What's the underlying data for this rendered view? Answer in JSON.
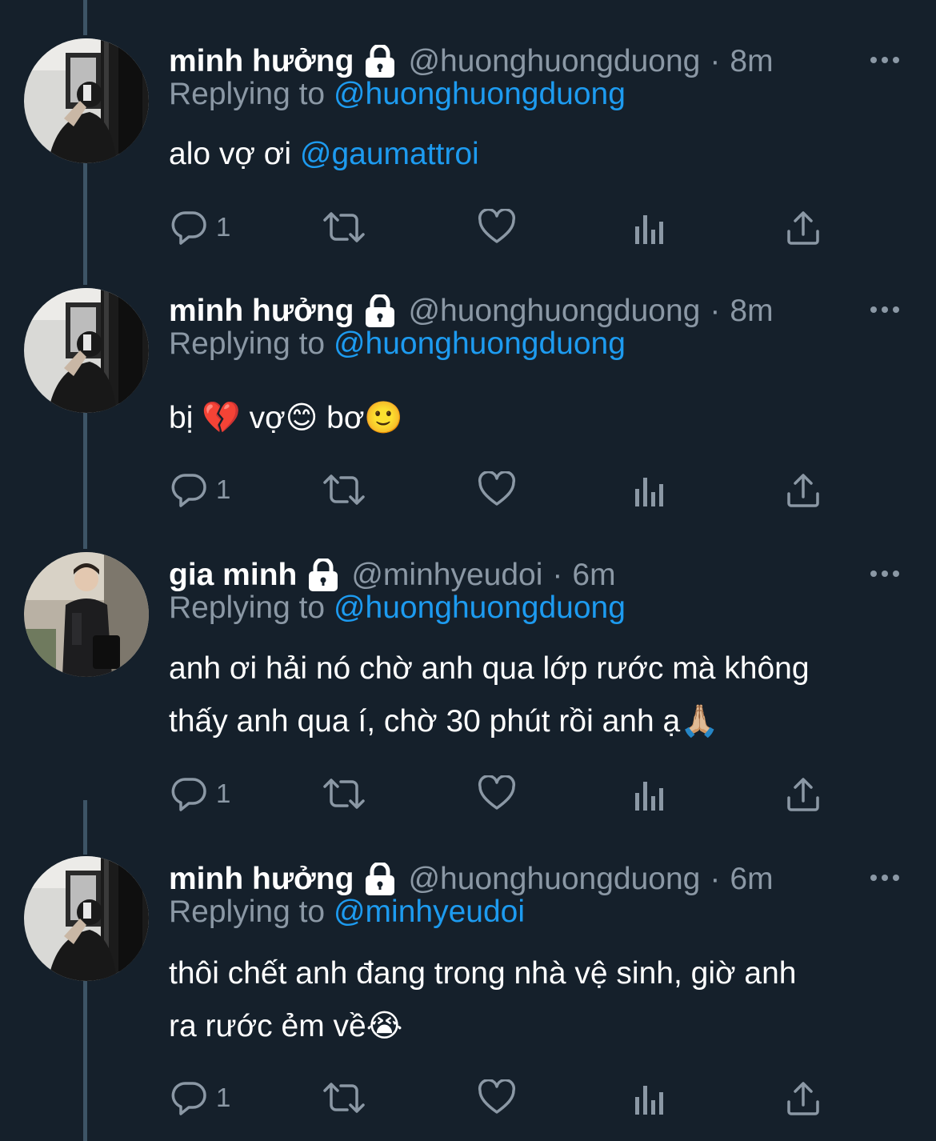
{
  "tweets": [
    {
      "display_name": "minh hưởng",
      "handle": "@huonghuongduong",
      "separator": "·",
      "time": "8m",
      "replying_prefix": "Replying to ",
      "replying_to": "@huonghuongduong",
      "text": "alo vợ ơi ",
      "text_mention": "@gaumattroi",
      "reply_count": "1"
    },
    {
      "display_name": "minh hưởng",
      "handle": "@huonghuongduong",
      "separator": "·",
      "time": "8m",
      "replying_prefix": "Replying to ",
      "replying_to": "@huonghuongduong",
      "text": "bị 💔 vợ😊 bơ🙂",
      "reply_count": "1"
    },
    {
      "display_name": "gia minh",
      "handle": "@minhyeudoi",
      "separator": "·",
      "time": "6m",
      "replying_prefix": "Replying to ",
      "replying_to": "@huonghuongduong",
      "text_line1": "anh ơi hải nó chờ anh qua lớp rước mà không",
      "text_line2": "thấy anh qua í, chờ 30 phút rồi anh ạ🙏🏼",
      "reply_count": "1"
    },
    {
      "display_name": "minh hưởng",
      "handle": "@huonghuongduong",
      "separator": "·",
      "time": "6m",
      "replying_prefix": "Replying to ",
      "replying_to": "@minhyeudoi",
      "text_line1": "thôi chết anh đang trong nhà vệ sinh, giờ anh",
      "text_line2": "ra rước ẻm về😭",
      "reply_count": "1"
    }
  ],
  "icons": {
    "lock": "lock-icon",
    "more": "more-icon",
    "reply": "reply-icon",
    "retweet": "retweet-icon",
    "like": "like-icon",
    "views": "views-icon",
    "share": "share-icon"
  },
  "colors": {
    "background": "#15202b",
    "text": "#ffffff",
    "secondary": "#8b98a5",
    "link": "#1d9bf0",
    "thread_line": "#3d5466"
  }
}
